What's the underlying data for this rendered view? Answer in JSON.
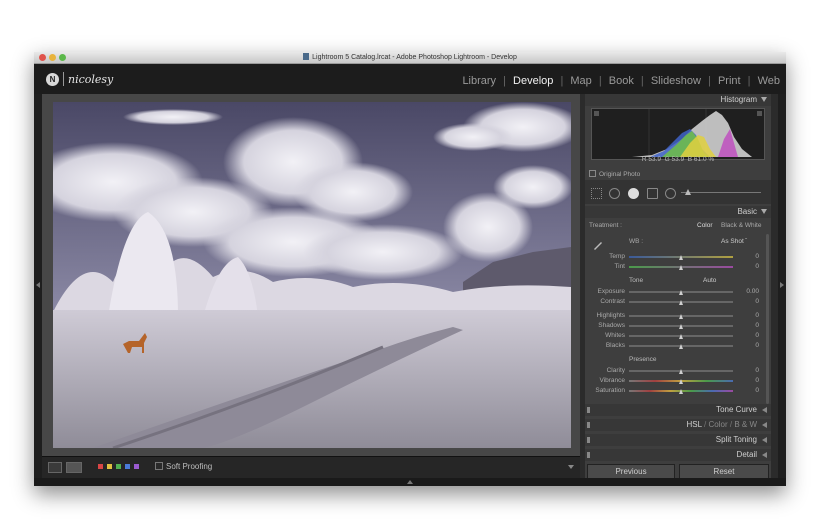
{
  "window": {
    "title": "Lightroom 5 Catalog.lrcat - Adobe Photoshop Lightroom - Develop"
  },
  "identity_plate": {
    "logo_initial": "N",
    "name": "nicolesy"
  },
  "modules": [
    {
      "label": "Library",
      "active": false
    },
    {
      "label": "Develop",
      "active": true
    },
    {
      "label": "Map",
      "active": false
    },
    {
      "label": "Book",
      "active": false
    },
    {
      "label": "Slideshow",
      "active": false
    },
    {
      "label": "Print",
      "active": false
    },
    {
      "label": "Web",
      "active": false
    }
  ],
  "module_separator": "|",
  "toolbar": {
    "soft_proofing_label": "Soft Proofing",
    "color_labels": [
      "#d84545",
      "#e0c040",
      "#50b050",
      "#4a7ad8",
      "#9a5ad0"
    ]
  },
  "histogram": {
    "header": "Histogram",
    "r_label": "R",
    "r_value": "53.9",
    "g_label": "G",
    "g_value": "53.9",
    "b_label": "B",
    "b_value": "61.0",
    "unit": "%",
    "original_photo_label": "Original Photo"
  },
  "basic": {
    "header": "Basic",
    "treatment_label": "Treatment :",
    "color_option": "Color",
    "bw_option": "Black & White",
    "wb_label": "WB :",
    "wb_value": "As Shot",
    "temp_label": "Temp",
    "temp_value": "0",
    "tint_label": "Tint",
    "tint_value": "0",
    "tone_label": "Tone",
    "auto_label": "Auto",
    "exposure_label": "Exposure",
    "exposure_value": "0.00",
    "contrast_label": "Contrast",
    "contrast_value": "0",
    "highlights_label": "Highlights",
    "highlights_value": "0",
    "shadows_label": "Shadows",
    "shadows_value": "0",
    "whites_label": "Whites",
    "whites_value": "0",
    "blacks_label": "Blacks",
    "blacks_value": "0",
    "presence_label": "Presence",
    "clarity_label": "Clarity",
    "clarity_value": "0",
    "vibrance_label": "Vibrance",
    "vibrance_value": "0",
    "saturation_label": "Saturation",
    "saturation_value": "0"
  },
  "panels": {
    "tone_curve": "Tone Curve",
    "hsl": "HSL",
    "hsl_sep": "/",
    "color": "Color",
    "bw": "B & W",
    "split_toning": "Split Toning",
    "detail": "Detail"
  },
  "buttons": {
    "previous": "Previous",
    "reset": "Reset"
  }
}
